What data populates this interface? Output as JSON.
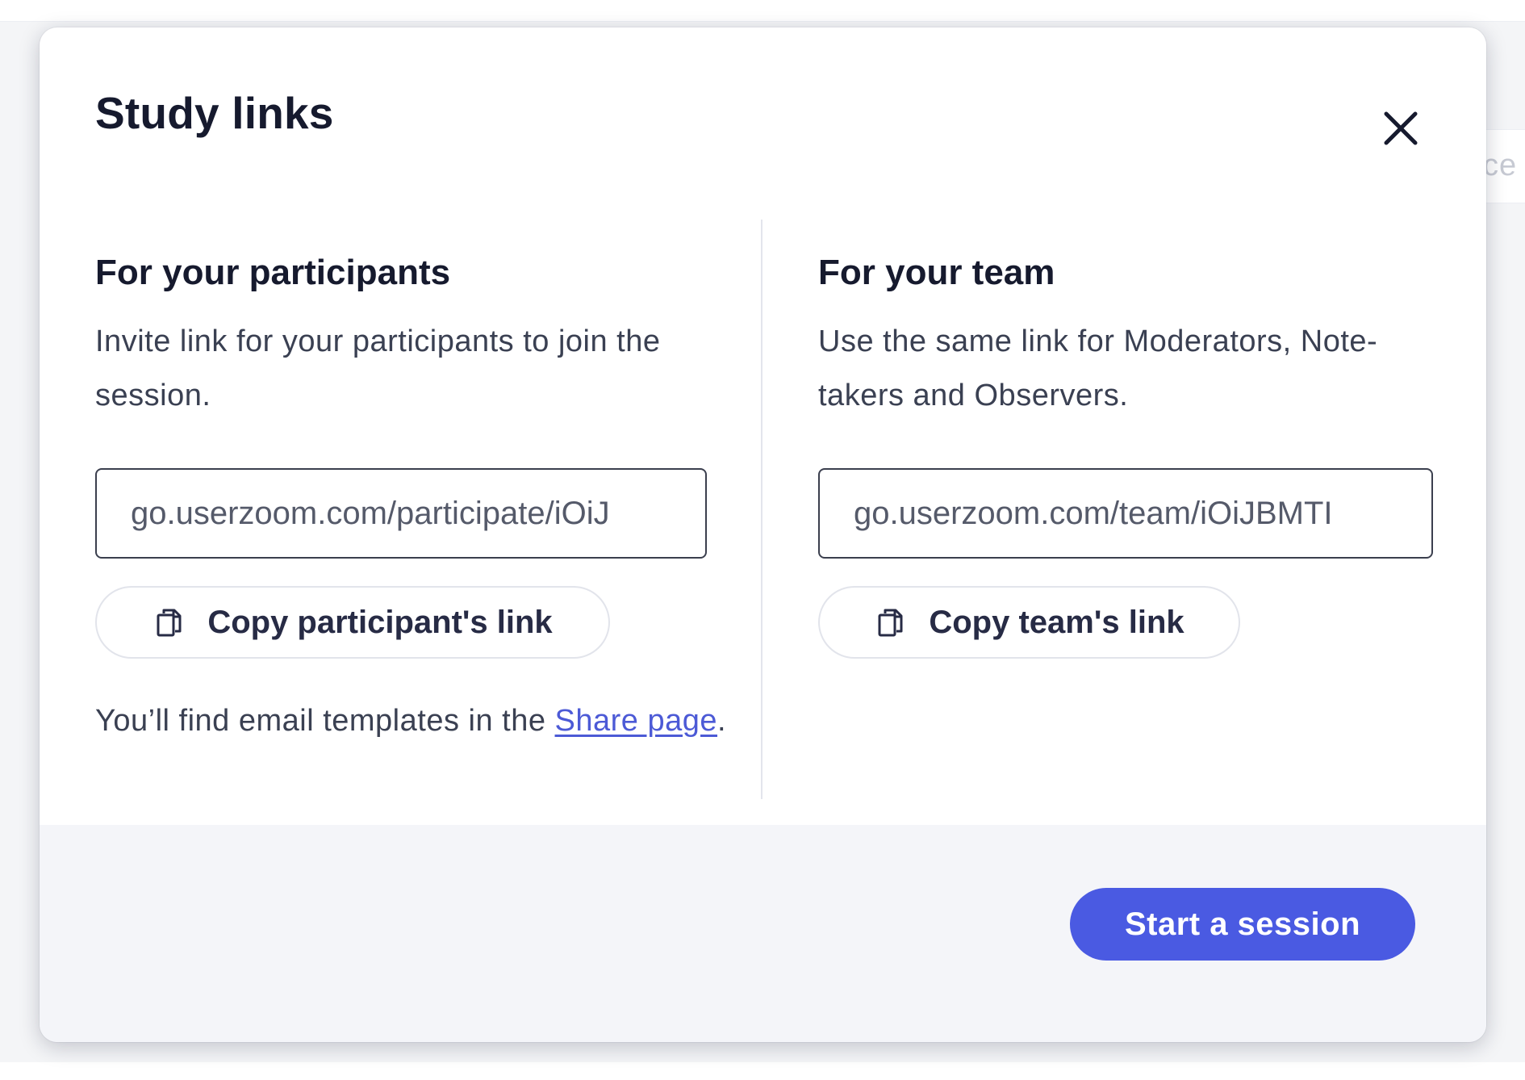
{
  "background": {
    "partial_text": "ce"
  },
  "modal": {
    "title": "Study links",
    "close_icon": "close-icon"
  },
  "participants": {
    "title": "For your participants",
    "description": "Invite link for your participants to join the session.",
    "link_value": "go.userzoom.com/participate/iOiJ",
    "copy_icon": "copy-icon",
    "copy_label": "Copy participant's link",
    "footnote_prefix": "You’ll find email templates in the ",
    "footnote_link": "Share page",
    "footnote_suffix": "."
  },
  "team": {
    "title": "For your team",
    "description": "Use the same link for Moderators, Note-takers and Observers.",
    "link_value": "go.userzoom.com/team/iOiJBMTI",
    "copy_icon": "copy-icon",
    "copy_label": "Copy team's link"
  },
  "footer": {
    "primary_label": "Start a session"
  },
  "colors": {
    "primary": "#4a5ae2",
    "link": "#4c5ad6",
    "text_dark": "#161a2e",
    "text_body": "#3a4052",
    "footer_bg": "#f4f5f9",
    "input_border": "#3b3f4e"
  }
}
